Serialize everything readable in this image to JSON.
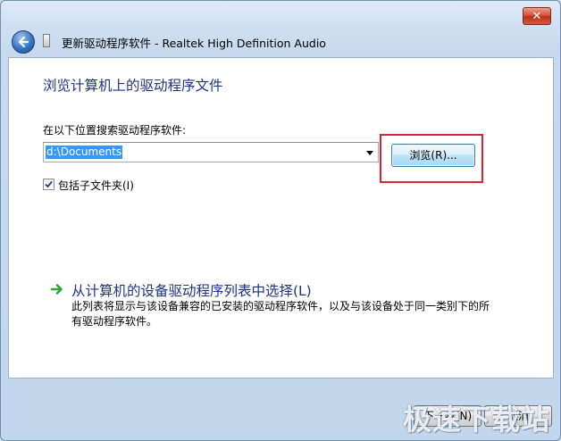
{
  "window": {
    "title": "更新驱动程序软件 - Realtek High Definition Audio",
    "close_label": "✕"
  },
  "main": {
    "heading": "浏览计算机上的驱动程序文件",
    "search_label": "在以下位置搜索驱动程序软件:",
    "path_value": "d:\\Documents",
    "browse_label": "浏览(R)...",
    "include_subfolders_label": "包括子文件夹(I)",
    "include_subfolders_checked": true,
    "pick_title": "从计算机的设备驱动程序列表中选择(L)",
    "pick_description": "此列表将显示与该设备兼容的已安装的驱动程序软件，以及与该设备处于同一类别下的所有驱动程序软件。"
  },
  "footer": {
    "next_label": "下一步(N)",
    "cancel_label": "取消"
  },
  "watermark": {
    "text": "极速下载站"
  },
  "colors": {
    "heading_blue": "#1e3287",
    "highlight_red": "#d9252b",
    "selection_blue": "#3399ff",
    "arrow_green": "#2aa832"
  },
  "icons": {
    "back": "back-arrow-icon",
    "device": "device-icon",
    "combo": "chevron-down-icon",
    "check": "checkmark-icon",
    "link": "green-arrow-icon"
  }
}
